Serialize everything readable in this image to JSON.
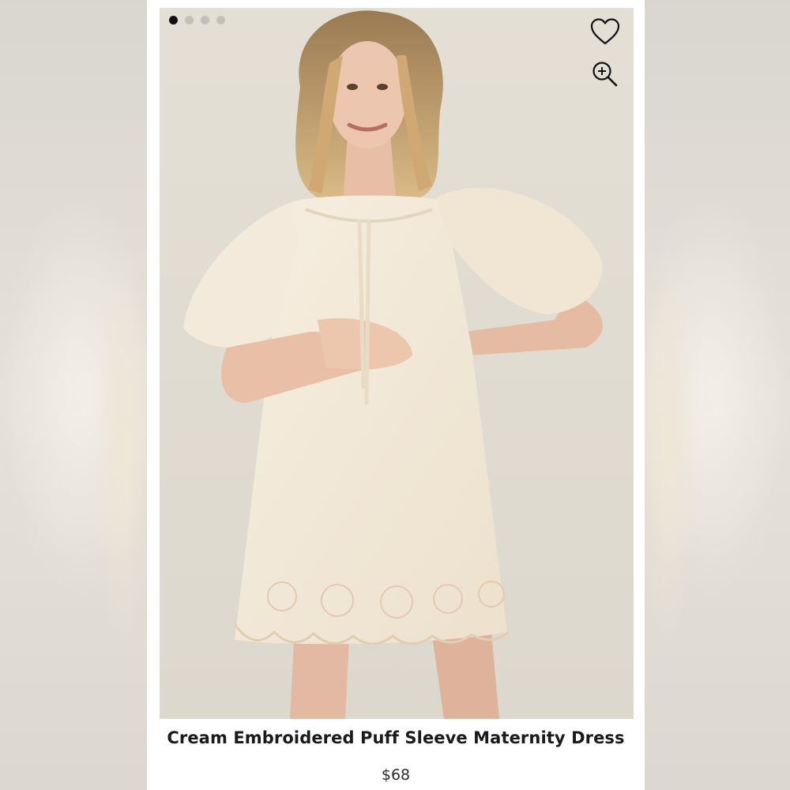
{
  "product": {
    "title": "Cream Embroidered Puff Sleeve Maternity Dress",
    "price": "$68"
  },
  "gallery": {
    "image_count": 4,
    "active_index": 0
  },
  "icons": {
    "favorite": "heart-icon",
    "zoom": "zoom-in-icon"
  },
  "colors": {
    "photo_background": "#e2ddd2",
    "dress": "#f3e9d8",
    "active_dot": "#111111",
    "inactive_dot": "#c4c0b9"
  }
}
